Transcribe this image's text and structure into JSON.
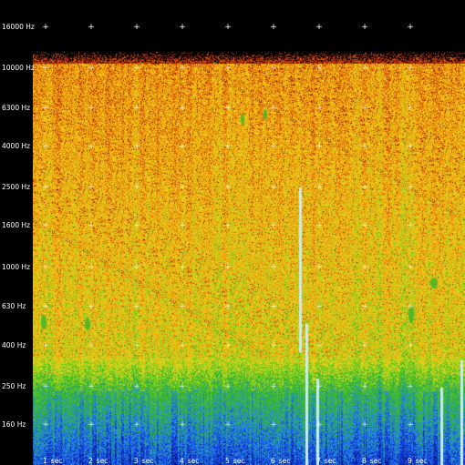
{
  "frequency_axis": {
    "labels": [
      "16000 Hz",
      "10000 Hz",
      "6300 Hz",
      "4000 Hz",
      "2500 Hz",
      "1600 Hz",
      "1000 Hz",
      "630 Hz",
      "400 Hz",
      "250 Hz",
      "160 Hz"
    ]
  },
  "time_axis": {
    "labels": [
      {
        "num": "1",
        "unit": "sec"
      },
      {
        "num": "2",
        "unit": "sec"
      },
      {
        "num": "3",
        "unit": "sec"
      },
      {
        "num": "4",
        "unit": "sec"
      },
      {
        "num": "5",
        "unit": "sec"
      },
      {
        "num": "6",
        "unit": "sec"
      },
      {
        "num": "7",
        "unit": "sec"
      },
      {
        "num": "8",
        "unit": "sec"
      },
      {
        "num": "9",
        "unit": "sec"
      }
    ]
  },
  "colors": {
    "background": "#000000",
    "label_text": "#ffffff",
    "high_energy_orange": "#e89a10",
    "mid_energy_yellow": "#e8d020",
    "low_band_green": "#30b020",
    "lowest_band_blue": "#1040e0"
  },
  "mark_glyph": "+"
}
